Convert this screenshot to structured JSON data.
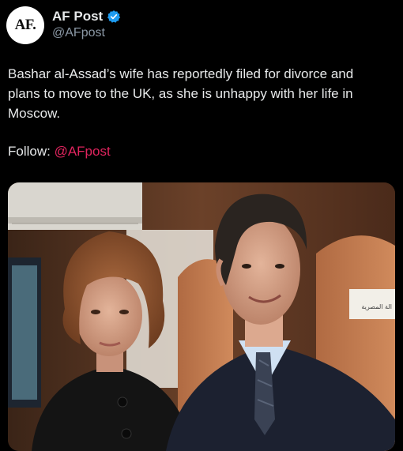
{
  "author": {
    "avatar_text": "AF.",
    "name": "AF Post",
    "handle": "@AFpost",
    "verified": true,
    "verified_color": "#1d9bf0"
  },
  "post": {
    "text": "Bashar al-Assad’s wife has reportedly filed for divorce and plans to move to the UK, as she is unhappy with her life in Moscow.",
    "follow_label": "Follow: ",
    "follow_mention": "@AFpost",
    "mention_color": "#e0245e"
  },
  "media": {
    "sign_text": "الة المصرية"
  },
  "colors": {
    "background": "#000000",
    "text": "#e7e9ea",
    "muted": "#8b98a5"
  }
}
